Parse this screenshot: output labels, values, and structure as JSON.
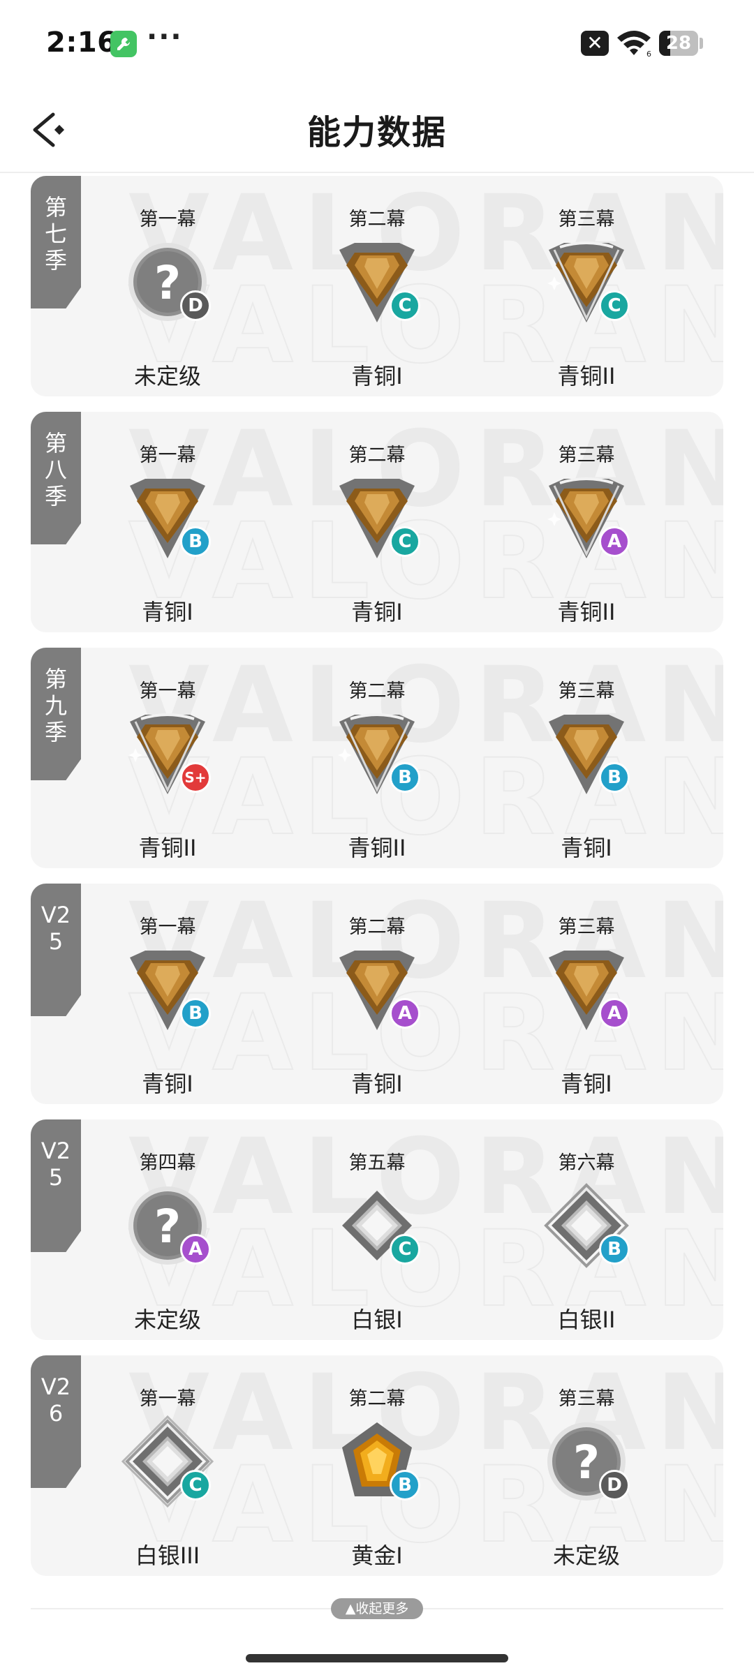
{
  "status_bar": {
    "time": "2:16",
    "more": "···",
    "battery": "28"
  },
  "header": {
    "title": "能力数据"
  },
  "footer": {
    "collapse_label": "▲收起更多"
  },
  "watermark": "VALORANT",
  "grade_colors": {
    "D": "#5a5a5a",
    "C": "#19a7a0",
    "B": "#22a0c9",
    "A": "#a64fcd",
    "S+": "#e23a3a"
  },
  "seasons": [
    {
      "label": "第七季",
      "acts": [
        {
          "name": "第一幕",
          "emblem": "unranked-icon",
          "grade": "D",
          "rank": "未定级"
        },
        {
          "name": "第二幕",
          "emblem": "bronze-1-icon",
          "grade": "C",
          "rank": "青铜I"
        },
        {
          "name": "第三幕",
          "emblem": "bronze-2-icon",
          "grade": "C",
          "rank": "青铜II"
        }
      ]
    },
    {
      "label": "第八季",
      "acts": [
        {
          "name": "第一幕",
          "emblem": "bronze-1-icon",
          "grade": "B",
          "rank": "青铜I"
        },
        {
          "name": "第二幕",
          "emblem": "bronze-1-icon",
          "grade": "C",
          "rank": "青铜I"
        },
        {
          "name": "第三幕",
          "emblem": "bronze-2-icon",
          "grade": "A",
          "rank": "青铜II"
        }
      ]
    },
    {
      "label": "第九季",
      "acts": [
        {
          "name": "第一幕",
          "emblem": "bronze-2-icon",
          "grade": "S+",
          "rank": "青铜II"
        },
        {
          "name": "第二幕",
          "emblem": "bronze-2-icon",
          "grade": "B",
          "rank": "青铜II"
        },
        {
          "name": "第三幕",
          "emblem": "bronze-1-icon",
          "grade": "B",
          "rank": "青铜I"
        }
      ]
    },
    {
      "label": "V25",
      "acts": [
        {
          "name": "第一幕",
          "emblem": "bronze-1-icon",
          "grade": "B",
          "rank": "青铜I"
        },
        {
          "name": "第二幕",
          "emblem": "bronze-1-icon",
          "grade": "A",
          "rank": "青铜I"
        },
        {
          "name": "第三幕",
          "emblem": "bronze-1-icon",
          "grade": "A",
          "rank": "青铜I"
        }
      ]
    },
    {
      "label": "V25",
      "acts": [
        {
          "name": "第四幕",
          "emblem": "unranked-icon",
          "grade": "A",
          "rank": "未定级"
        },
        {
          "name": "第五幕",
          "emblem": "silver-1-icon",
          "grade": "C",
          "rank": "白银I"
        },
        {
          "name": "第六幕",
          "emblem": "silver-2-icon",
          "grade": "B",
          "rank": "白银II"
        }
      ]
    },
    {
      "label": "V26",
      "acts": [
        {
          "name": "第一幕",
          "emblem": "silver-3-icon",
          "grade": "C",
          "rank": "白银III"
        },
        {
          "name": "第二幕",
          "emblem": "gold-1-icon",
          "grade": "B",
          "rank": "黄金I"
        },
        {
          "name": "第三幕",
          "emblem": "unranked-icon",
          "grade": "D",
          "rank": "未定级"
        }
      ]
    }
  ]
}
